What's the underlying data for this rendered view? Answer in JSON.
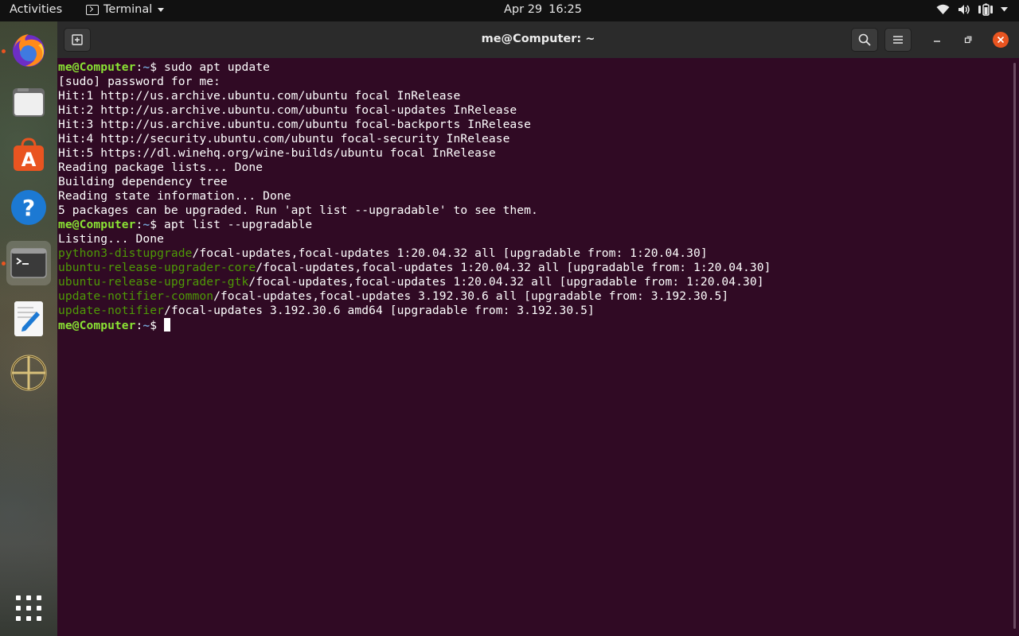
{
  "topbar": {
    "activities": "Activities",
    "app_name": "Terminal",
    "date": "Apr 29",
    "time": "16:25",
    "tray_icons": [
      "wifi-icon",
      "volume-icon",
      "battery-icon",
      "power-menu-caret-icon"
    ]
  },
  "dock": {
    "items": [
      {
        "name": "firefox",
        "icon": "firefox-icon",
        "running": true
      },
      {
        "name": "files",
        "icon": "files-icon",
        "running": false
      },
      {
        "name": "ubuntu-software",
        "icon": "software-icon",
        "running": false
      },
      {
        "name": "help",
        "icon": "help-icon",
        "running": false
      },
      {
        "name": "terminal",
        "icon": "terminal-icon",
        "running": true,
        "active": true
      },
      {
        "name": "text-editor",
        "icon": "text-editor-icon",
        "running": false
      },
      {
        "name": "wine",
        "icon": "wine-icon",
        "running": false
      }
    ],
    "show_apps_icon": "app-grid-icon"
  },
  "window": {
    "title": "me@Computer: ~",
    "buttons": [
      "new-tab-icon",
      "search-icon",
      "hamburger-menu-icon",
      "minimize-icon",
      "maximize-icon",
      "close-icon"
    ],
    "colors": {
      "background": "#300a24",
      "prompt_user": "#8ae234",
      "prompt_path": "#729fcf",
      "package": "#4e9a06",
      "close": "#e95420"
    }
  },
  "terminal": {
    "prompt_user": "me@Computer",
    "prompt_path": "~",
    "lines": [
      {
        "type": "cmd",
        "text": "sudo apt update"
      },
      {
        "type": "out",
        "text": "[sudo] password for me:"
      },
      {
        "type": "out",
        "text": "Hit:1 http://us.archive.ubuntu.com/ubuntu focal InRelease"
      },
      {
        "type": "out",
        "text": "Hit:2 http://us.archive.ubuntu.com/ubuntu focal-updates InRelease"
      },
      {
        "type": "out",
        "text": "Hit:3 http://us.archive.ubuntu.com/ubuntu focal-backports InRelease"
      },
      {
        "type": "out",
        "text": "Hit:4 http://security.ubuntu.com/ubuntu focal-security InRelease"
      },
      {
        "type": "out",
        "text": "Hit:5 https://dl.winehq.org/wine-builds/ubuntu focal InRelease"
      },
      {
        "type": "out",
        "text": "Reading package lists... Done"
      },
      {
        "type": "out",
        "text": "Building dependency tree"
      },
      {
        "type": "out",
        "text": "Reading state information... Done"
      },
      {
        "type": "out",
        "text": "5 packages can be upgraded. Run 'apt list --upgradable' to see them."
      },
      {
        "type": "cmd",
        "text": "apt list --upgradable"
      },
      {
        "type": "out",
        "text": "Listing... Done"
      },
      {
        "type": "pkg",
        "pkg": "python3-distupgrade",
        "rest": "/focal-updates,focal-updates 1:20.04.32 all [upgradable from: 1:20.04.30]"
      },
      {
        "type": "pkg",
        "pkg": "ubuntu-release-upgrader-core",
        "rest": "/focal-updates,focal-updates 1:20.04.32 all [upgradable from: 1:20.04.30]"
      },
      {
        "type": "pkg",
        "pkg": "ubuntu-release-upgrader-gtk",
        "rest": "/focal-updates,focal-updates 1:20.04.32 all [upgradable from: 1:20.04.30]"
      },
      {
        "type": "pkg",
        "pkg": "update-notifier-common",
        "rest": "/focal-updates,focal-updates 3.192.30.6 all [upgradable from: 3.192.30.5]"
      },
      {
        "type": "pkg",
        "pkg": "update-notifier",
        "rest": "/focal-updates 3.192.30.6 amd64 [upgradable from: 3.192.30.5]"
      },
      {
        "type": "cmd",
        "text": ""
      }
    ]
  }
}
